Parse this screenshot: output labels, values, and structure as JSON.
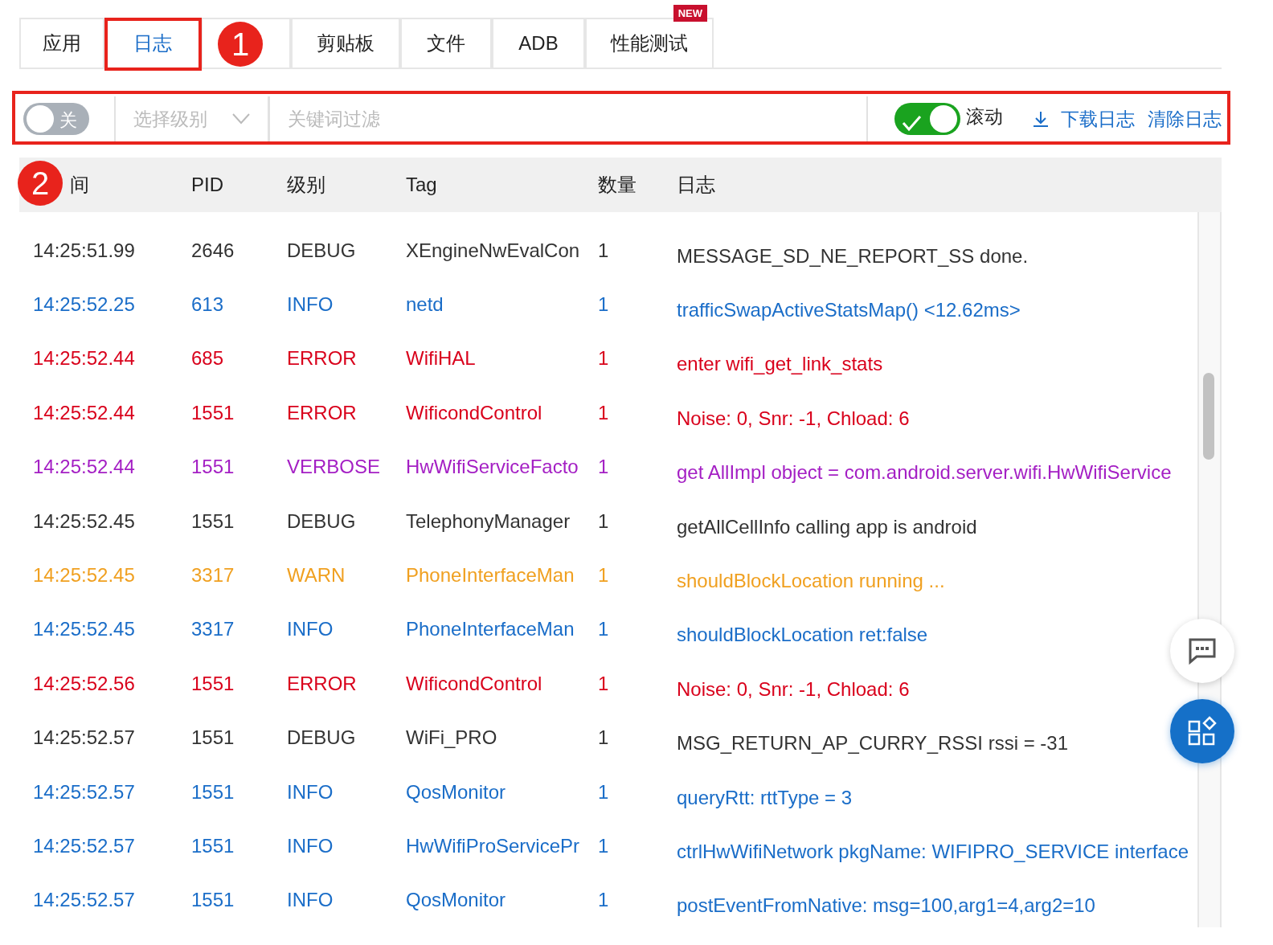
{
  "tabs": [
    {
      "label": "应用",
      "selected": false
    },
    {
      "label": "日志",
      "selected": true
    },
    {
      "selected": false
    },
    {
      "label": "剪贴板",
      "selected": false
    },
    {
      "label": "文件",
      "selected": false
    },
    {
      "label": "ADB",
      "selected": false
    },
    {
      "label": "性能测试",
      "selected": false,
      "badge": "NEW"
    }
  ],
  "toolbar": {
    "enable_switch": {
      "label": "关",
      "on": false
    },
    "level_select": {
      "placeholder": "选择级别"
    },
    "keyword_filter": {
      "placeholder": "关键词过滤"
    },
    "scroll_switch": {
      "label": "滚动",
      "on": true
    },
    "download_link": "下载日志",
    "clear_link": "清除日志"
  },
  "table": {
    "columns": [
      "间",
      "PID",
      "级别",
      "Tag",
      "数量",
      "日志"
    ],
    "rows": [
      {
        "color": "#333333",
        "cells": [
          "14:25:51.99",
          "2646",
          "DEBUG",
          "XEngineNwEvalCon",
          "1",
          "MESSAGE_SD_NE_REPORT_SS done."
        ]
      },
      {
        "color": "#1a6dc8",
        "cells": [
          "14:25:52.25",
          "613",
          "INFO",
          "netd",
          "1",
          "trafficSwapActiveStatsMap() <12.62ms>"
        ]
      },
      {
        "color": "#d9001b",
        "cells": [
          "14:25:52.44",
          "685",
          "ERROR",
          "WifiHAL",
          "1",
          "enter wifi_get_link_stats"
        ]
      },
      {
        "color": "#d9001b",
        "cells": [
          "14:25:52.44",
          "1551",
          "ERROR",
          "WificondControl",
          "1",
          "Noise: 0, Snr: -1, Chload: 6"
        ]
      },
      {
        "color": "#a41fc4",
        "cells": [
          "14:25:52.44",
          "1551",
          "VERBOSE",
          "HwWifiServiceFacto",
          "1",
          "get AllImpl object = com.android.server.wifi.HwWifiService"
        ]
      },
      {
        "color": "#333333",
        "cells": [
          "14:25:52.45",
          "1551",
          "DEBUG",
          "TelephonyManager",
          "1",
          "getAllCellInfo calling app is android"
        ]
      },
      {
        "color": "#f0a020",
        "cells": [
          "14:25:52.45",
          "3317",
          "WARN",
          "PhoneInterfaceMan",
          "1",
          "shouldBlockLocation running ..."
        ]
      },
      {
        "color": "#1a6dc8",
        "cells": [
          "14:25:52.45",
          "3317",
          "INFO",
          "PhoneInterfaceMan",
          "1",
          "shouldBlockLocation ret:false"
        ]
      },
      {
        "color": "#d9001b",
        "cells": [
          "14:25:52.56",
          "1551",
          "ERROR",
          "WificondControl",
          "1",
          "Noise: 0, Snr: -1, Chload: 6"
        ]
      },
      {
        "color": "#333333",
        "cells": [
          "14:25:52.57",
          "1551",
          "DEBUG",
          "WiFi_PRO",
          "1",
          "MSG_RETURN_AP_CURRY_RSSI rssi = -31"
        ]
      },
      {
        "color": "#1a6dc8",
        "cells": [
          "14:25:52.57",
          "1551",
          "INFO",
          "QosMonitor",
          "1",
          "queryRtt: rttType = 3"
        ]
      },
      {
        "color": "#1a6dc8",
        "cells": [
          "14:25:52.57",
          "1551",
          "INFO",
          "HwWifiProServicePr",
          "1",
          "ctrlHwWifiNetwork pkgName: WIFIPRO_SERVICE interface"
        ]
      },
      {
        "color": "#1a6dc8",
        "cells": [
          "14:25:52.57",
          "1551",
          "INFO",
          "QosMonitor",
          "1",
          "postEventFromNative: msg=100,arg1=4,arg2=10"
        ]
      }
    ]
  },
  "annotations": [
    {
      "label": "1"
    },
    {
      "label": "2"
    }
  ]
}
